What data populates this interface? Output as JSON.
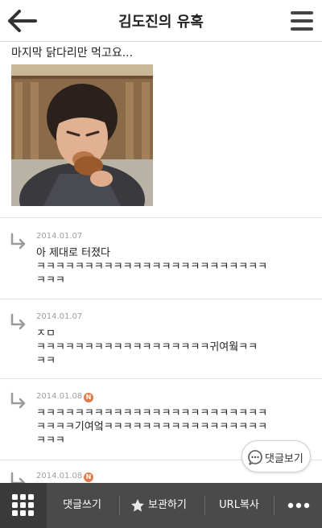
{
  "header": {
    "title": "김도진의 유혹",
    "back_icon": "back-arrow-icon",
    "menu_icon": "hamburger-menu-icon"
  },
  "post": {
    "text": "마지막 닭다리만 먹고요..."
  },
  "comments": [
    {
      "date": "2014.01.07",
      "line1": "아 제대로 터졌다",
      "line2": "ㅋㅋㅋㅋㅋㅋㅋㅋㅋㅋㅋㅋㅋㅋㅋㅋㅋㅋㅋㅋㅋㅋㅋㅋ",
      "line3": "ㅋㅋㅋ",
      "badge": ""
    },
    {
      "date": "2014.01.07",
      "line1": "ㅈㅁ",
      "line2": "ㅋㅋㅋㅋㅋㅋㅋㅋㅋㅋㅋㅋㅋㅋㅋㅋㅋㅋ귀여웤ㅋㅋ",
      "line3": "ㅋㅋ",
      "badge": ""
    },
    {
      "date": "2014.01.08",
      "line1": "ㅋㅋㅋㅋㅋㅋㅋㅋㅋㅋㅋㅋㅋㅋㅋㅋㅋㅋㅋㅋㅋㅋㅋㅋ",
      "line2": "ㅋㅋㅋㅋ기여엌ㅋㅋㅋㅋㅋㅋㅋㅋㅋㅋㅋㅋㅋㅋㅋㅋㅋ",
      "line3": "ㅋㅋㅋ",
      "badge": "N"
    },
    {
      "date": "2014.01.08",
      "line1": "",
      "line2": "",
      "line3": "",
      "badge": "N"
    }
  ],
  "floating_button": {
    "label": "댓글보기",
    "icon": "speech-bubble-icon"
  },
  "bottom_bar": {
    "grid_icon": "grid-menu-icon",
    "write_comment": "댓글쓰기",
    "bookmark": "보관하기",
    "bookmark_icon": "star-icon",
    "copy_url": "URL복사",
    "more_icon": "more-dots-icon"
  },
  "colors": {
    "badge": "#e07c4c",
    "bottom_bar": "#4a4a4a",
    "arrow": "#9a9a9a"
  }
}
